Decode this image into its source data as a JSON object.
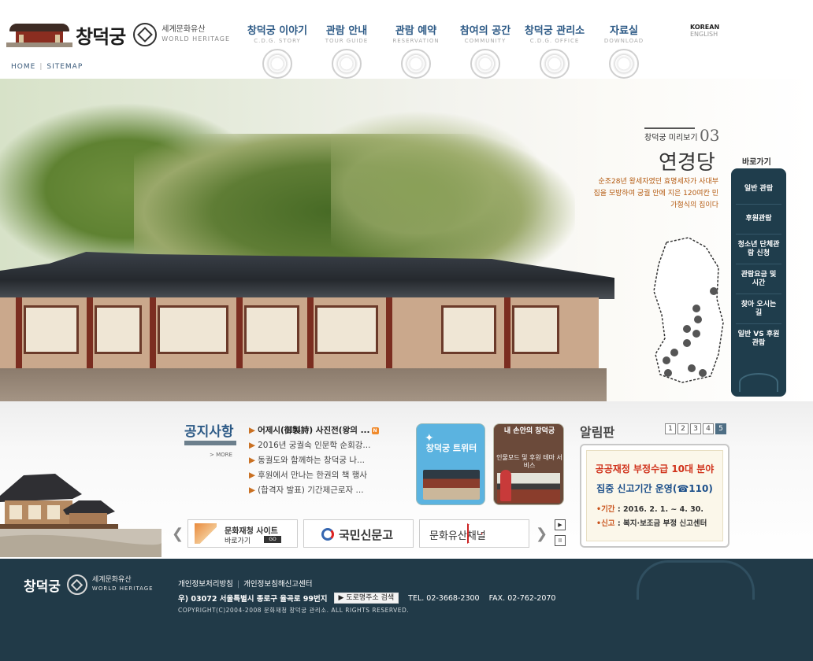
{
  "header": {
    "logo_name": "창덕궁",
    "world_heritage_ko": "세계문화유산",
    "world_heritage_en": "WORLD HERITAGE",
    "util": {
      "home": "HOME",
      "sitemap": "SITEMAP"
    },
    "nav": [
      {
        "ko": "창덕궁 이야기",
        "en": "C.D.G. STORY"
      },
      {
        "ko": "관람 안내",
        "en": "TOUR GUIDE"
      },
      {
        "ko": "관람 예약",
        "en": "RESERVATION"
      },
      {
        "ko": "참여의 공간",
        "en": "COMMUNITY"
      },
      {
        "ko": "창덕궁 관리소",
        "en": "C.D.G. OFFICE"
      },
      {
        "ko": "자료실",
        "en": "DOWNLOAD"
      }
    ],
    "lang": {
      "korean": "KOREAN",
      "english": "ENGLISH"
    }
  },
  "hero": {
    "label": "창덕궁 미리보기",
    "number": "03",
    "title": "연경당",
    "description": "순조28년 왕세자였던 효명세자가 사대부집을 모방하여 궁궐 안에 지은 120여칸 민가형식의 집이다"
  },
  "quick": {
    "title": "바로가기",
    "items": [
      "일반 관람",
      "후원관람",
      "청소년 단체관람 신청",
      "관람요금 및 시간",
      "찾아 오시는 길",
      "일반 VS 후원 관람"
    ]
  },
  "notice": {
    "title": "공지사항",
    "more": "> MORE",
    "items": [
      "어제시(御製詩) 사진전(왕의 ...",
      "2016년 궁궐속 인문학 순회강...",
      "동궐도와 함께하는 창덕궁 나...",
      "후원에서 만나는 한권의 책 행사",
      "(합격자 발표) 기간제근로자 ..."
    ],
    "new_badge": "N"
  },
  "banners": {
    "twitter": {
      "title": "창덕궁 트위터"
    },
    "mobile": {
      "title": "내 손안의 창덕궁",
      "subtitle": "인물모드 및 후원 테마 서비스"
    }
  },
  "board": {
    "title": "알림판",
    "pages": [
      "1",
      "2",
      "3",
      "4",
      "5"
    ],
    "active_page": "5",
    "line1": "공공재정 부정수급 10대 분야",
    "line2": "집중 신고기간 운영(☎110)",
    "period_label": "•기간",
    "period_value": " : 2016. 2. 1. ~ 4. 30.",
    "report_label": "•신고",
    "report_value": " : 복지·보조금 부정 신고센터"
  },
  "links": {
    "link1_a": "문화재청 사이트",
    "link1_b": "바로가기",
    "link1_go": "GO",
    "link2": "국민신문고",
    "link3": "문화유산채널",
    "play": "▶",
    "pause": "II"
  },
  "footer": {
    "name": "창덕궁",
    "heritage_ko": "세계문화유산",
    "heritage_en": "WORLD HERITAGE",
    "privacy": "개인정보처리방침",
    "report": "개인정보침해신고센터",
    "address": "우) 03072 서울특별시 종로구 율곡로 99번지",
    "road_btn": "도로명주소 검색",
    "tel": "TEL. 02-3668-2300",
    "fax": "FAX. 02-762-2070",
    "copyright": "COPYRIGHT(C)2004-2008 문화재청 창덕궁 관리소. ALL RIGHTS RESERVED."
  },
  "colors": {
    "nav_blue": "#2d5a86",
    "quick_bg": "#1f3d4c",
    "footer_bg": "#213a48",
    "accent_orange": "#c97022",
    "board_red": "#d0321b"
  }
}
